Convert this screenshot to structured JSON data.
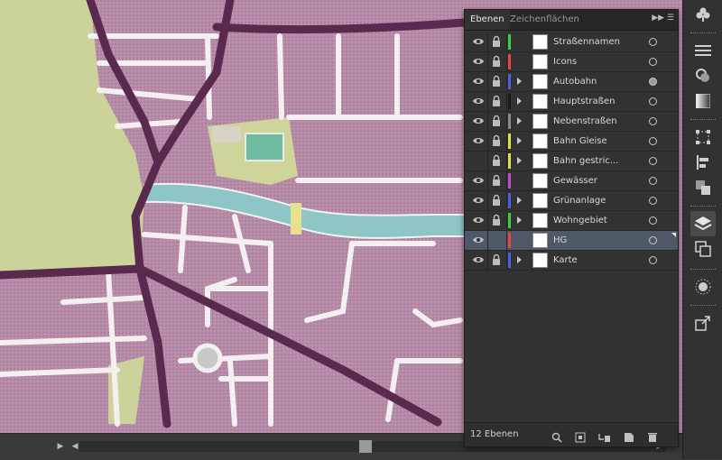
{
  "layers_panel": {
    "tabs": [
      {
        "label": "Ebenen"
      },
      {
        "label": "Zeichenflächen"
      }
    ],
    "layers": [
      {
        "name": "Straßennamen",
        "color": "#3ecf3e",
        "visible": true,
        "locked": true,
        "has_children": false,
        "selected": false
      },
      {
        "name": "Icons",
        "color": "#e84646",
        "visible": true,
        "locked": true,
        "has_children": false,
        "selected": false
      },
      {
        "name": "Autobahn",
        "color": "#4a62e0",
        "visible": true,
        "locked": true,
        "has_children": true,
        "selected": false
      },
      {
        "name": "Hauptstraßen",
        "color": "#1a1a1a",
        "visible": true,
        "locked": true,
        "has_children": true,
        "selected": false
      },
      {
        "name": "Nebenstraßen",
        "color": "#8a8a8a",
        "visible": true,
        "locked": true,
        "has_children": true,
        "selected": false
      },
      {
        "name": "Bahn Gleise",
        "color": "#e8e03a",
        "visible": true,
        "locked": true,
        "has_children": true,
        "selected": false
      },
      {
        "name": "Bahn gestric...",
        "color": "#e8e03a",
        "visible": false,
        "locked": true,
        "has_children": true,
        "selected": false
      },
      {
        "name": "Gewässer",
        "color": "#c04ad0",
        "visible": true,
        "locked": true,
        "has_children": false,
        "selected": false
      },
      {
        "name": "Grünanlage",
        "color": "#4a62e0",
        "visible": true,
        "locked": true,
        "has_children": true,
        "selected": false
      },
      {
        "name": "Wohngebiet",
        "color": "#3ecf3e",
        "visible": true,
        "locked": true,
        "has_children": true,
        "selected": false
      },
      {
        "name": "HG",
        "color": "#e84646",
        "visible": true,
        "locked": false,
        "has_children": false,
        "selected": true
      },
      {
        "name": "Karte",
        "color": "#4a62e0",
        "visible": true,
        "locked": true,
        "has_children": true,
        "selected": false
      }
    ],
    "footer": {
      "count_label": "12 Ebenen",
      "icons": [
        "search-icon",
        "clipping-mask-icon",
        "new-sublayer-icon",
        "new-layer-icon",
        "trash-icon"
      ]
    }
  },
  "right_toolbar": {
    "icons": [
      "club-icon",
      "lines-icon",
      "appearance-icon",
      "gradient-icon",
      "transform-icon",
      "align-icon",
      "pathfinder-icon",
      "layers-icon",
      "artboards-icon",
      "sun-icon",
      "export-icon"
    ]
  },
  "colors": {
    "residential": "#b58aa6",
    "green": "#cfd49a",
    "water": "#8ec6c8",
    "main_road": "#5a2a4e",
    "panel_bg": "#323232",
    "selection": "#4e5868"
  }
}
